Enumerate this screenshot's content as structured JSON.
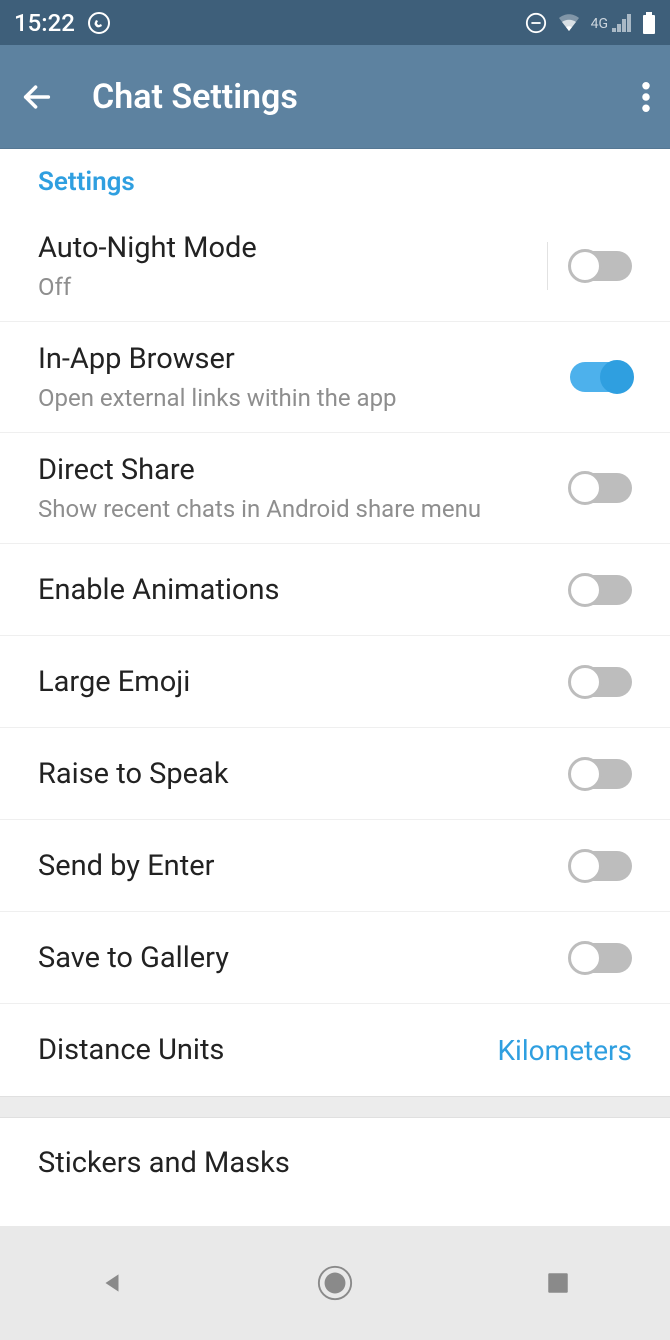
{
  "status": {
    "time": "15:22",
    "network_label": "4G"
  },
  "header": {
    "title": "Chat Settings"
  },
  "section_label": "Settings",
  "rows": {
    "auto_night": {
      "title": "Auto-Night Mode",
      "sub": "Off"
    },
    "in_app_browser": {
      "title": "In-App Browser",
      "sub": "Open external links within the app"
    },
    "direct_share": {
      "title": "Direct Share",
      "sub": "Show recent chats in Android share menu"
    },
    "enable_animations": {
      "title": "Enable Animations"
    },
    "large_emoji": {
      "title": "Large Emoji"
    },
    "raise_to_speak": {
      "title": "Raise to Speak"
    },
    "send_by_enter": {
      "title": "Send by Enter"
    },
    "save_to_gallery": {
      "title": "Save to Gallery"
    },
    "distance_units": {
      "title": "Distance Units",
      "value": "Kilometers"
    },
    "stickers": {
      "title": "Stickers and Masks"
    }
  },
  "toggles": {
    "auto_night": false,
    "in_app_browser": true,
    "direct_share": false,
    "enable_animations": false,
    "large_emoji": false,
    "raise_to_speak": false,
    "send_by_enter": false,
    "save_to_gallery": false
  }
}
